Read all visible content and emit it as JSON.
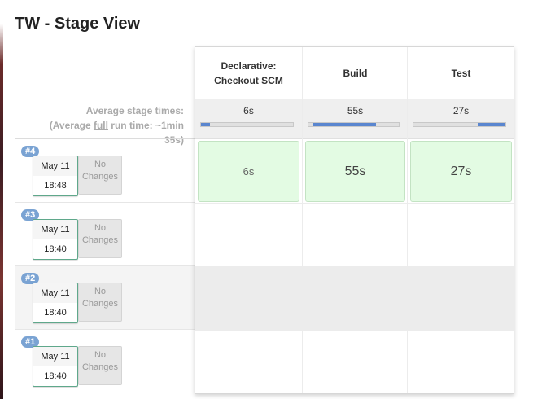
{
  "page": {
    "title": "TW - Stage View"
  },
  "averages": {
    "line1": "Average stage times:",
    "line2_prefix": "(Average ",
    "line2_link": "full",
    "line2_suffix": " run time: ~1min",
    "line3": "35s)"
  },
  "stages": [
    {
      "name_line1": "Declarative:",
      "name_line2": "Checkout SCM",
      "avg": "6s",
      "avg_fill_fraction": 0.1
    },
    {
      "name_line1": "Build",
      "name_line2": "",
      "avg": "55s",
      "avg_fill_fraction": 0.7
    },
    {
      "name_line1": "Test",
      "name_line2": "",
      "avg": "27s",
      "avg_fill_fraction": 0.3
    }
  ],
  "builds": [
    {
      "number": "#4",
      "date": "May 11",
      "time": "18:48",
      "changes_line1": "No",
      "changes_line2": "Changes",
      "durations": [
        "6s",
        "55s",
        "27s"
      ]
    },
    {
      "number": "#3",
      "date": "May 11",
      "time": "18:40",
      "changes_line1": "No",
      "changes_line2": "Changes"
    },
    {
      "number": "#2",
      "date": "May 11",
      "time": "18:40",
      "changes_line1": "No",
      "changes_line2": "Changes"
    },
    {
      "number": "#1",
      "date": "May 11",
      "time": "18:40",
      "changes_line1": "No",
      "changes_line2": "Changes"
    }
  ],
  "colors": {
    "success_cell": "#e3fbe3",
    "progress_fill": "#5a86cf",
    "badge": "#7aa3d3"
  }
}
